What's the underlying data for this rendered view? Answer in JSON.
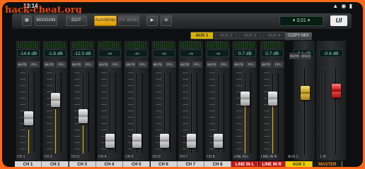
{
  "status": {
    "time": "13:14",
    "system_icons": "▲ ◉ ▮"
  },
  "watermark": "hack-cheat.org",
  "toolbar": {
    "mix_gain": "MIX/GAIN",
    "edit": "EDIT",
    "auxsend": "AUXSEND",
    "fx_send": "FX SEND",
    "scene": "▾ 3:01 ▾",
    "logo": "UI"
  },
  "aux_tabs": [
    "AUX 1",
    "AUX 2",
    "AUX 3",
    "AUX 4"
  ],
  "copy_mix": "COPY MIX",
  "mute_label": "MUTE",
  "pfl_label": "PFL",
  "solo_label": "SOLO",
  "channels": [
    {
      "db": "-14.6 dB",
      "name": "CH 1",
      "small": "CH 1",
      "fader_level": 0.42,
      "fill": 0.3
    },
    {
      "db": "-1.8 dB",
      "name": "CH 2",
      "small": "CH 2",
      "fader_level": 0.7,
      "fill": 0.55
    },
    {
      "db": "-12.3 dB",
      "name": "CH 3",
      "small": "CH 3",
      "fader_level": 0.45,
      "fill": 0.35
    },
    {
      "db": "-∞",
      "name": "CH 4",
      "small": "CH 4",
      "fader_level": 0.08,
      "fill": 0
    },
    {
      "db": "-∞",
      "name": "CH 5",
      "small": "CH 5",
      "fader_level": 0.08,
      "fill": 0
    },
    {
      "db": "-∞",
      "name": "CH 6",
      "small": "CH 6",
      "fader_level": 0.08,
      "fill": 0
    },
    {
      "db": "-∞",
      "name": "CH 7",
      "small": "CH 7",
      "fader_level": 0.08,
      "fill": 0
    },
    {
      "db": "-∞",
      "name": "CH 8",
      "small": "CH 8",
      "fader_level": 0.08,
      "fill": 0
    },
    {
      "db": "0.7 dB",
      "name": "LINE IN L",
      "small": "LINE IN L",
      "fader_level": 0.72,
      "fill": 0.6
    },
    {
      "db": "0.7 dB",
      "name": "LINE IN R",
      "small": "LINE IN R",
      "fader_level": 0.72,
      "fill": 0.6
    }
  ],
  "aux": {
    "db": "-3.1 dB",
    "name": "AUX 1",
    "small": "AUX 1",
    "fader_level": 0.75
  },
  "master": {
    "db": "-0.6 dB",
    "name": "MASTER",
    "small": "L  R",
    "fader_level": 0.78
  },
  "colors": {
    "accent": "#d9b300",
    "line_in": "#c01818",
    "master_text": "#ff8c1a",
    "display_text": "#8fe0c8"
  }
}
